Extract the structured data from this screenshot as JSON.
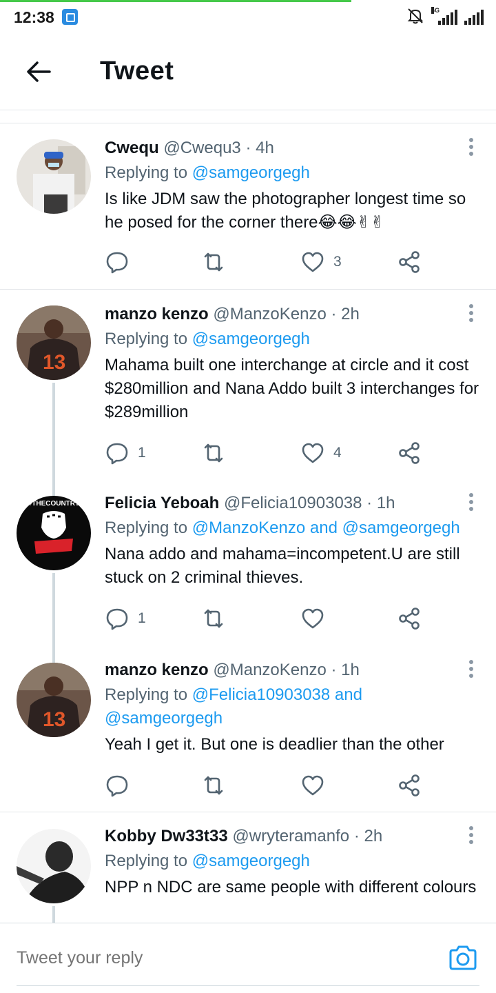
{
  "status_bar": {
    "time": "12:38",
    "network_label": "4G",
    "icons": [
      "app-notification-icon",
      "silent-bell-icon",
      "signal-4g-icon",
      "signal-icon"
    ]
  },
  "header": {
    "title": "Tweet",
    "back_icon": "arrow-left-icon"
  },
  "colors": {
    "link": "#1d9bf0",
    "muted": "#536471",
    "divider": "#e2e5e8"
  },
  "tweets": [
    {
      "name": "Cwequ",
      "handle": "@Cwequ3",
      "time": "4h",
      "replying_prefix": "Replying to",
      "replying_to": "@samgeorgegh",
      "text": "Is like JDM saw the photographer longest time so he posed for the corner there😂😂✌✌",
      "replies": "",
      "retweets": "",
      "likes": "3"
    },
    {
      "name": "manzo kenzo",
      "handle": "@ManzoKenzo",
      "time": "2h",
      "replying_prefix": "Replying to",
      "replying_to": "@samgeorgegh",
      "text": "Mahama built one interchange at circle and it cost $280million and Nana Addo built 3 interchanges for $289million",
      "replies": "1",
      "retweets": "",
      "likes": "4"
    },
    {
      "name": "Felicia Yeboah",
      "handle": "@Felicia10903038",
      "time": "1h",
      "replying_prefix": "Replying to",
      "replying_to": "@ManzoKenzo and @samgeorgegh",
      "text": "Nana addo and mahama=incompetent.U are still stuck on 2 criminal thieves.",
      "replies": "1",
      "retweets": "",
      "likes": "",
      "avatar_text": "#THECOUNTRY"
    },
    {
      "name": "manzo kenzo",
      "handle": "@ManzoKenzo",
      "time": "1h",
      "replying_prefix": "Replying to",
      "replying_to": "@Felicia10903038 and @samgeorgegh",
      "text": "Yeah I get it. But one is deadlier than the other",
      "replies": "",
      "retweets": "",
      "likes": ""
    },
    {
      "name": "Kobby Dw33t33",
      "handle": "@wryteramanfo",
      "time": "2h",
      "replying_prefix": "Replying to",
      "replying_to": "@samgeorgegh",
      "text": "NPP n NDC are same people with different colours"
    }
  ],
  "reply_bar": {
    "placeholder": "Tweet your reply",
    "camera_icon": "camera-icon"
  }
}
